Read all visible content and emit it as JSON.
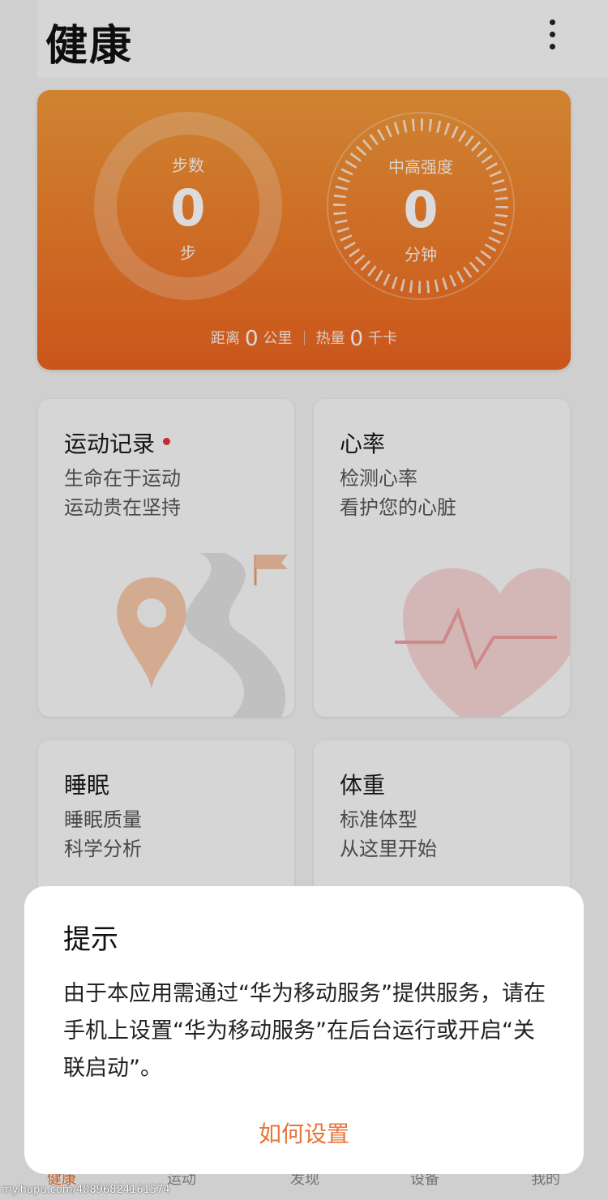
{
  "header": {
    "title": "健康"
  },
  "summary": {
    "steps": {
      "label": "步数",
      "value": "0",
      "unit": "步"
    },
    "intensity": {
      "label": "中高强度",
      "value": "0",
      "unit": "分钟"
    },
    "distance": {
      "label": "距离",
      "value": "0",
      "unit": "公里"
    },
    "calories": {
      "label": "热量",
      "value": "0",
      "unit": "千卡"
    }
  },
  "tiles": [
    {
      "title": "运动记录",
      "line1": "生命在于运动",
      "line2": "运动贵在坚持"
    },
    {
      "title": "心率",
      "line1": "检测心率",
      "line2": "看护您的心脏"
    },
    {
      "title": "睡眠",
      "line1": "睡眠质量",
      "line2": "科学分析"
    },
    {
      "title": "体重",
      "line1": "标准体型",
      "line2": "从这里开始"
    }
  ],
  "dialog": {
    "title": "提示",
    "message": "由于本应用需通过“华为移动服务”提供服务，请在手机上设置“华为移动服务”在后台运行或开启“关联启动”。",
    "button": "如何设置"
  },
  "nav": [
    "健康",
    "运动",
    "发现",
    "设备",
    "我的"
  ],
  "watermark": "my.hupu.com/40896824161574",
  "colors": {
    "accent": "#ec6c2a",
    "dialog_button": "#e8743a",
    "notification_dot": "#e8313a"
  },
  "icons": [
    "more-vertical-icon",
    "location-pin-icon",
    "flag-icon",
    "heart-pulse-icon"
  ]
}
